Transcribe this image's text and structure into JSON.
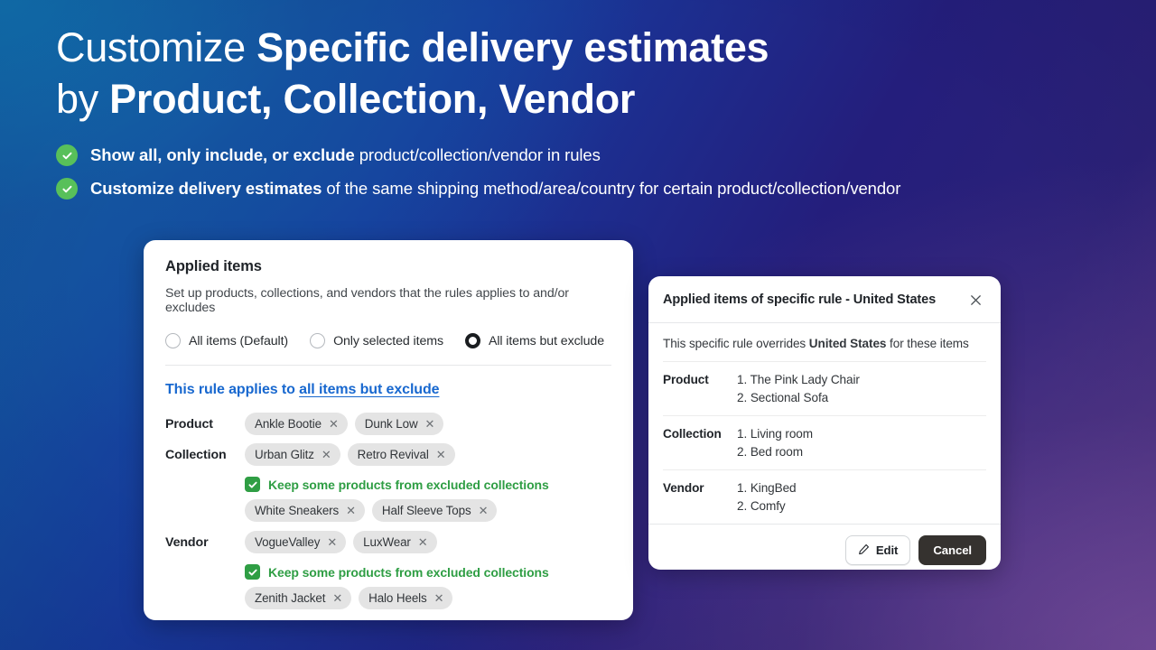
{
  "background": {
    "top_left_color": "#10609f",
    "top_right_color": "#241e7c",
    "bottom_left_color": "#173a9e",
    "bottom_right_color": "#4a3184"
  },
  "hero": {
    "title_line1_normal": "Customize ",
    "title_line1_bold": "Specific delivery estimates",
    "title_line2_normal": "by ",
    "title_line2_bold": "Product, Collection, Vendor",
    "bullets": [
      {
        "icon": "check-circle-icon",
        "bold": "Show all, only include, or exclude",
        "rest": " product/collection/vendor in rules"
      },
      {
        "icon": "check-circle-icon",
        "bold": "Customize delivery estimates",
        "rest": " of the same shipping method/area/country for certain product/collection/vendor"
      }
    ],
    "check_color": "#58c05a"
  },
  "applied_items_card": {
    "title": "Applied items",
    "subtitle": "Set up products, collections, and vendors that the rules applies to and/or excludes",
    "radios": [
      {
        "label": "All items (Default)",
        "selected": false
      },
      {
        "label": "Only selected items",
        "selected": false
      },
      {
        "label": "All items but exclude",
        "selected": true
      }
    ],
    "rule_link_prefix": "This rule applies to ",
    "rule_link_target": "all items but exclude",
    "link_color": "#1868cf",
    "rows": [
      {
        "label": "Product",
        "chips": [
          "Ankle Bootie",
          "Dunk Low"
        ]
      },
      {
        "label": "Collection",
        "chips": [
          "Urban Glitz",
          "Retro Revival"
        ],
        "keep_label": "Keep some products from excluded collections",
        "keep_checked": true,
        "keep_chips": [
          "White Sneakers",
          "Half Sleeve Tops"
        ]
      },
      {
        "label": "Vendor",
        "chips": [
          "VogueValley",
          "LuxWear"
        ],
        "keep_label": "Keep some products from excluded collections",
        "keep_checked": true,
        "keep_chips": [
          "Zenith Jacket",
          "Halo Heels"
        ]
      }
    ],
    "chip_remove_icon": "close-icon",
    "keep_color": "#2f9e44"
  },
  "specific_rule_modal": {
    "title": "Applied items of specific rule - United States",
    "close_icon": "close-icon",
    "description_prefix": "This specific rule overrides ",
    "description_bold": "United States",
    "description_suffix": " for these items",
    "rows": [
      {
        "label": "Product",
        "items": [
          "1. The Pink Lady Chair",
          "2. Sectional Sofa"
        ]
      },
      {
        "label": "Collection",
        "items": [
          "1. Living room",
          "2. Bed room"
        ]
      },
      {
        "label": "Vendor",
        "items": [
          "1. KingBed",
          "2. Comfy"
        ]
      }
    ],
    "edit_label": "Edit",
    "edit_icon": "pencil-icon",
    "cancel_label": "Cancel",
    "cancel_bg": "#35322f"
  }
}
